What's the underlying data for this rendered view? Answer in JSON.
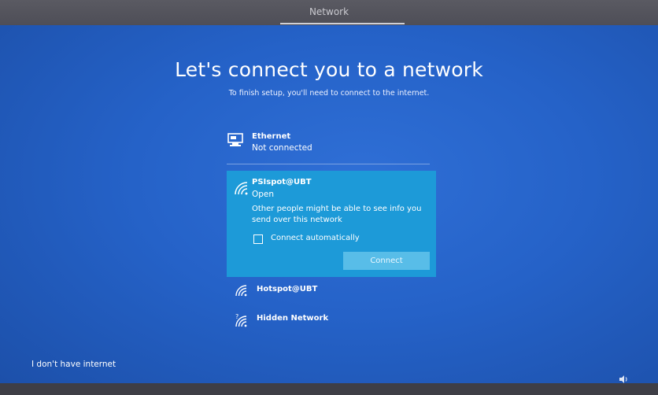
{
  "header": {
    "title": "Network"
  },
  "main": {
    "title": "Let's connect you to a network",
    "subtitle": "To finish setup, you'll need to connect to the internet."
  },
  "networks": {
    "ethernet": {
      "name": "Ethernet",
      "status": "Not connected",
      "icon": "ethernet-icon"
    },
    "selected": {
      "name": "PSIspot@UBT",
      "status": "Open",
      "warning": "Other people might be able to see info you send over this network",
      "connect_automatically_label": "Connect automatically",
      "connect_automatically_checked": false,
      "connect_button": "Connect",
      "icon": "wifi-icon"
    },
    "hotspot": {
      "name": "Hotspot@UBT",
      "icon": "wifi-icon"
    },
    "hidden": {
      "name": "Hidden Network",
      "icon": "wifi-hidden-icon"
    }
  },
  "footer": {
    "no_internet": "I don't have internet",
    "volume_icon": "volume-icon"
  },
  "colors": {
    "background": "#2562c8",
    "selected": "#1d9ad8",
    "button": "#58bde8"
  }
}
